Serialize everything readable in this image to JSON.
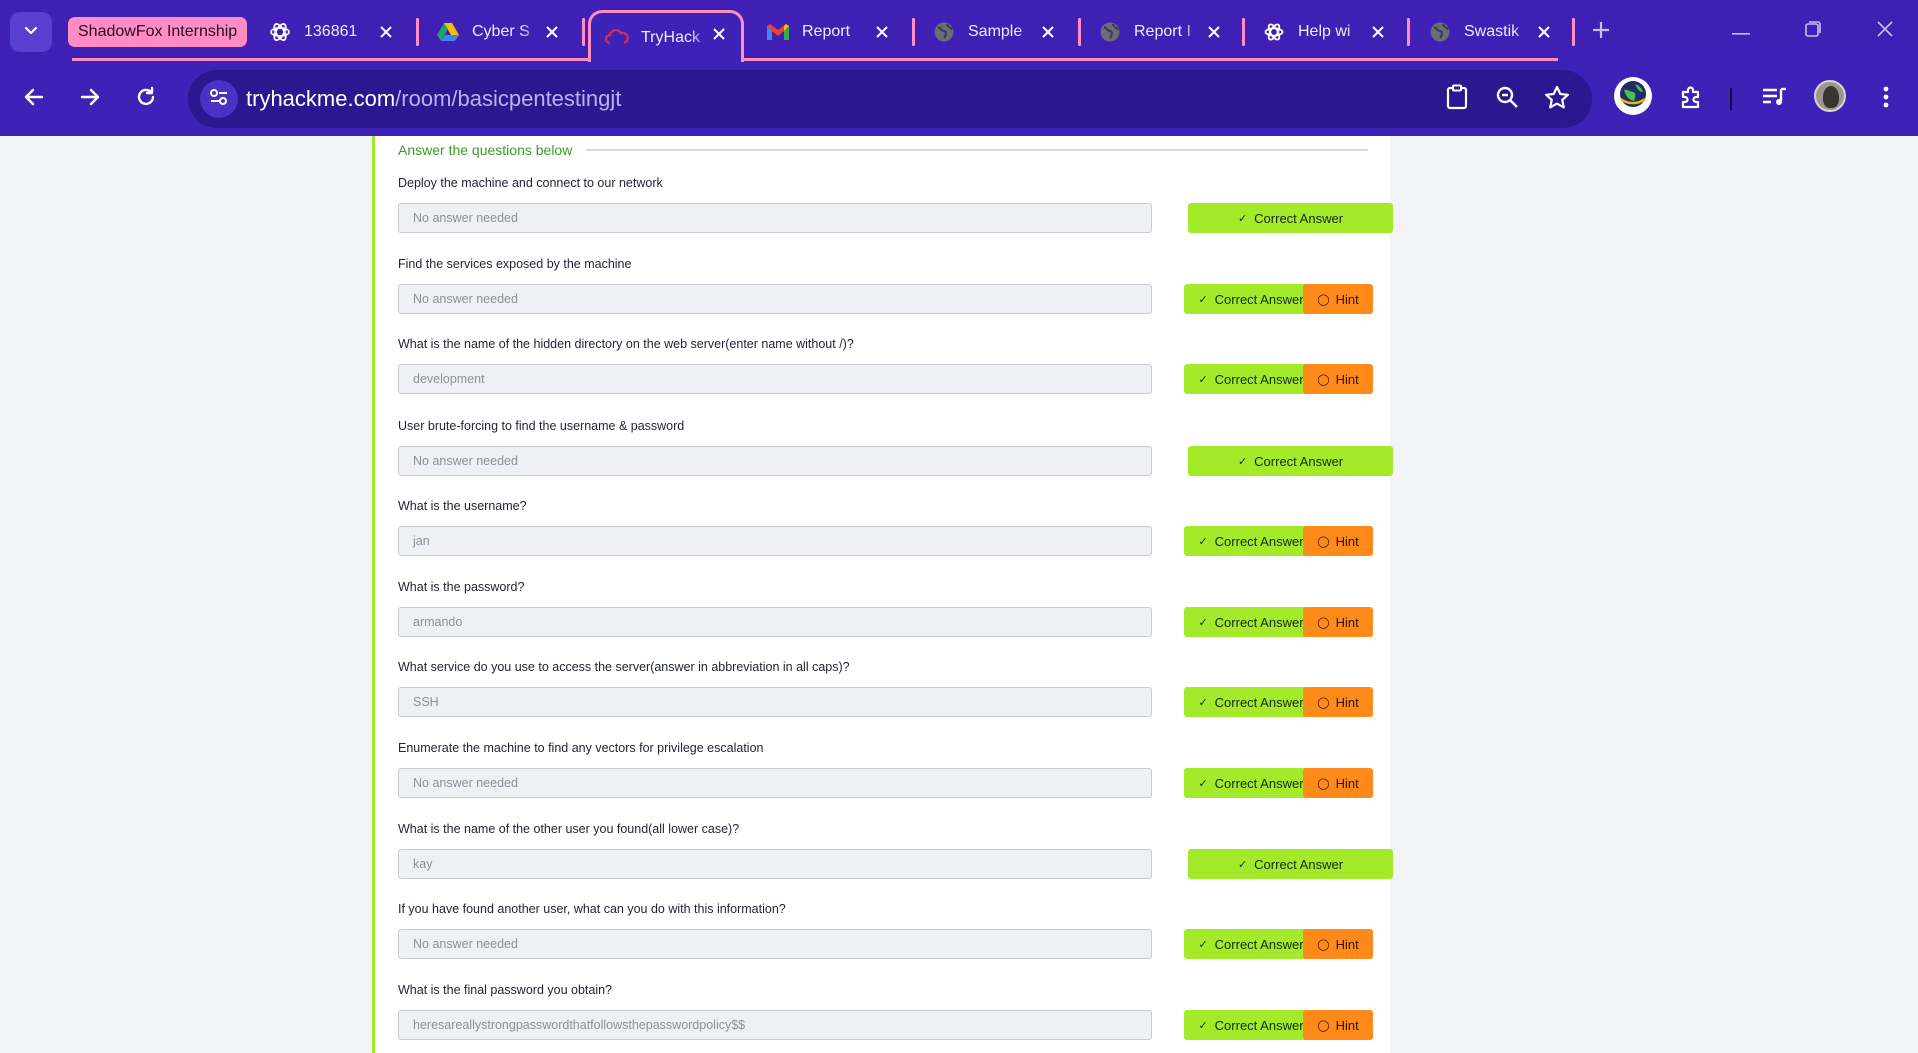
{
  "tabstrip": {
    "group_label": "ShadowFox Internship",
    "tabs": [
      {
        "title": "136861",
        "icon": "chatgpt-like-icon"
      },
      {
        "title": "Cyber S",
        "icon": "google-drive-icon"
      },
      {
        "title": "TryHack",
        "icon": "tryhackme-icon",
        "active": true
      },
      {
        "title": "Report",
        "icon": "gmail-icon"
      },
      {
        "title": "Sample",
        "icon": "globe-icon"
      },
      {
        "title": "Report I",
        "icon": "globe-icon"
      },
      {
        "title": "Help wi",
        "icon": "openai-icon"
      },
      {
        "title": "Swastik",
        "icon": "globe-icon"
      }
    ]
  },
  "toolbar": {
    "url_host": "tryhackme.com",
    "url_path": "/room/basicpentestingjt"
  },
  "section": {
    "title": "Answer the questions below"
  },
  "buttons": {
    "correct_label": "Correct Answer",
    "hint_label": "Hint"
  },
  "questions": [
    {
      "text": "Deploy the machine and connect to our network",
      "answer": "No answer needed",
      "hint": false
    },
    {
      "text": "Find the services exposed by the machine",
      "answer": "No answer needed",
      "hint": true
    },
    {
      "text": "What is the name of the hidden directory on the web server(enter name without /)?",
      "answer": "development",
      "hint": true
    },
    {
      "text": "User brute-forcing to find the username & password",
      "answer": "No answer needed",
      "hint": false
    },
    {
      "text": "What is the username?",
      "answer": "jan",
      "hint": true
    },
    {
      "text": "What is the password?",
      "answer": "armando",
      "hint": true
    },
    {
      "text": "What service do you use to access the server(answer in abbreviation in all caps)?",
      "answer": "SSH",
      "hint": true
    },
    {
      "text": "Enumerate the machine to find any vectors for privilege escalation",
      "answer": "No answer needed",
      "hint": true
    },
    {
      "text": "What is the name of the other user you found(all lower case)?",
      "answer": "kay",
      "hint": false
    },
    {
      "text": "If you have found another user, what can you do with this information?",
      "answer": "No answer needed",
      "hint": true
    },
    {
      "text": "What is the final password you obtain?",
      "answer": "heresareallystrongpasswordthatfollowsthepasswordpolicy$$",
      "hint": true
    }
  ],
  "colors": {
    "browser_frame": "#3d22b8",
    "tab_group": "#ff8cc3",
    "correct": "#a3ea2a",
    "hint": "#ff8a1a",
    "section_title": "#3a9c28"
  }
}
